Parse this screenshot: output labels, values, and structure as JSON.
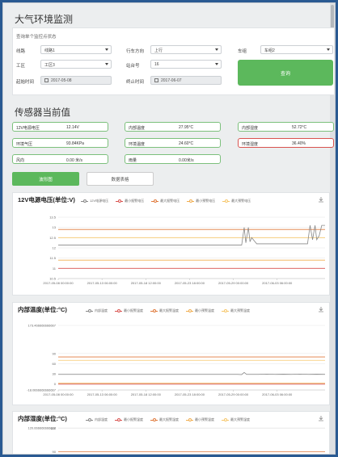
{
  "page_title": "大气环境监测",
  "query": {
    "hint": "查询单个监控点状态",
    "line_label": "线路",
    "line_value": "线路1",
    "direction_label": "行车方向",
    "direction_value": "上行",
    "vehicle_label": "车组",
    "vehicle_value": "车组2",
    "work_label": "工区",
    "work_value": "工区3",
    "station_label": "站台号",
    "station_value": "16",
    "start_label": "起始时间",
    "start_value": "2017-05-08",
    "end_label": "终止时间",
    "end_value": "2017-06-07",
    "query_button": "查询"
  },
  "sensors": {
    "title": "传感器当前值",
    "items": [
      {
        "label": "12V电源电压",
        "value": "12.14V",
        "status": "normal"
      },
      {
        "label": "内部温度",
        "value": "27.95°C",
        "status": "normal"
      },
      {
        "label": "内部湿度",
        "value": "52.72°C",
        "status": "normal"
      },
      {
        "label": "环境气压",
        "value": "93.84KPa",
        "status": "normal"
      },
      {
        "label": "环境温度",
        "value": "24.60°C",
        "status": "normal"
      },
      {
        "label": "环境湿度",
        "value": "36.40%",
        "status": "alarm"
      },
      {
        "label": "风向",
        "value": "0.00 米/s",
        "status": "normal"
      },
      {
        "label": "雨量",
        "value": "0.00米/s",
        "status": "normal"
      }
    ]
  },
  "tabs": {
    "curve": "波形图",
    "table": "数据表格"
  },
  "colors": {
    "accent_green": "#5cb85c",
    "alarm_red": "#d9534f",
    "series_gray": "#888888",
    "min_alarm": "#d9534f",
    "max_alarm": "#e07a3c",
    "min_warn": "#f0ad4e",
    "max_warn": "#f6c66a"
  },
  "icons": {
    "export": "download-icon",
    "calendar": "calendar-icon",
    "dropdown": "chevron-down-icon"
  },
  "chart_data": [
    {
      "type": "line",
      "title": "12V电源电压(单位:V)",
      "xlabel": "",
      "ylabel": "",
      "x_ticks": [
        "2017-05-08 00:00:00",
        "2017-05-13 06:00:00",
        "2017-05-18 12:00:00",
        "2017-05-23 18:00:00",
        "2017-05-29 00:00:00",
        "2017-06-03 06:00:00"
      ],
      "y_ticks": [
        "13.5",
        "13",
        "12.5",
        "12",
        "11.5",
        "11",
        "10.5"
      ],
      "ylim": [
        10.5,
        13.5
      ],
      "x_range_days": [
        0,
        30
      ],
      "legend": [
        "12V电源电压",
        "最小报警电压",
        "最大报警电压",
        "最小预警电压",
        "最大预警电压"
      ],
      "series": [
        {
          "name": "12V电源电压",
          "points": [
            [
              0,
              12.14
            ],
            [
              22,
              12.14
            ],
            [
              22.3,
              13.0
            ],
            [
              22.5,
              12.25
            ],
            [
              22.8,
              13.0
            ],
            [
              23.0,
              12.3
            ],
            [
              23.2,
              12.5
            ],
            [
              23.5,
              12.35
            ],
            [
              23.8,
              12.2
            ],
            [
              24.5,
              12.2
            ],
            [
              29.9,
              12.2
            ],
            [
              30.2,
              13.1
            ],
            [
              30.5,
              12.4
            ],
            [
              30.8,
              13.1
            ],
            [
              31.0,
              12.4
            ],
            [
              31.3,
              12.6
            ],
            [
              31.6,
              13.1
            ],
            [
              32,
              13.1
            ]
          ]
        },
        {
          "name": "最小报警电压",
          "points": [
            [
              0,
              11
            ],
            [
              32,
              11
            ]
          ]
        },
        {
          "name": "最大报警电压",
          "points": [
            [
              0,
              12.9
            ],
            [
              32,
              12.9
            ]
          ]
        },
        {
          "name": "最小预警电压",
          "points": [
            [
              0,
              11.4
            ],
            [
              32,
              11.4
            ]
          ]
        },
        {
          "name": "最大预警电压",
          "points": [
            [
              0,
              12.5
            ],
            [
              32,
              12.5
            ]
          ]
        }
      ]
    },
    {
      "type": "line",
      "title": "内部温度(单位:°C)",
      "xlabel": "",
      "ylabel": "",
      "x_ticks": [
        "2017-05-08 00:00:00",
        "2017-05-13 06:00:00",
        "2017-05-18 12:00:00",
        "2017-05-23 18:00:00",
        "2017-05-29 00:00:00",
        "2017-06-03 06:00:00"
      ],
      "y_ticks": [
        "173.466666666667",
        "90",
        "60",
        "30",
        "0",
        "-18.0666666666667"
      ],
      "ylim": [
        -18.0666666666667,
        173.466666666667
      ],
      "x_range_days": [
        0,
        30
      ],
      "legend": [
        "内部温度",
        "最小报警温度",
        "最大报警温度",
        "最小预警温度",
        "最大预警温度"
      ],
      "series": [
        {
          "name": "内部温度",
          "points": [
            [
              0,
              28
            ],
            [
              21.5,
              28
            ],
            [
              22,
              27.5
            ],
            [
              22.3,
              34
            ],
            [
              22.6,
              28
            ],
            [
              24,
              28
            ],
            [
              25,
              29
            ],
            [
              26,
              28
            ],
            [
              27,
              28.5
            ],
            [
              28,
              28
            ],
            [
              29,
              29
            ],
            [
              30,
              28
            ],
            [
              31,
              28.5
            ],
            [
              32,
              28
            ]
          ]
        },
        {
          "name": "最小报警温度",
          "points": [
            [
              0,
              -0.8
            ],
            [
              32,
              -0.8
            ]
          ]
        },
        {
          "name": "最大报警温度",
          "points": [
            [
              0,
              80
            ],
            [
              32,
              80
            ]
          ]
        },
        {
          "name": "最小预警温度",
          "points": [
            [
              0,
              2
            ],
            [
              32,
              2
            ]
          ]
        },
        {
          "name": "最大预警温度",
          "points": [
            [
              0,
              70
            ],
            [
              32,
              70
            ]
          ]
        }
      ]
    },
    {
      "type": "line",
      "title": "内部湿度(单位:°C)",
      "xlabel": "",
      "ylabel": "",
      "y_ticks": [
        "120.666666666667",
        "120",
        "90"
      ],
      "ylim": [
        0,
        120.666666666667
      ],
      "legend": [
        "内部湿度",
        "最小报警湿度",
        "最大报警湿度",
        "最小预警湿度",
        "最大预警湿度"
      ],
      "series": [
        {
          "name": "最大报警湿度",
          "points": [
            [
              0,
              90
            ],
            [
              32,
              90
            ]
          ]
        }
      ]
    }
  ]
}
